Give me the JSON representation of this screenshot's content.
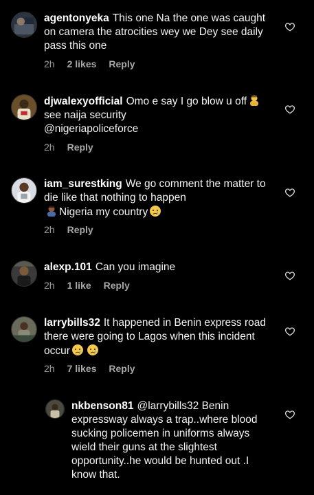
{
  "comments": [
    {
      "username": "agentonyeka",
      "text": "This one Na the one was caught on camera the atrocities wey we Dey see daily pass this one",
      "time": "2h",
      "likes": "2 likes",
      "reply": "Reply"
    },
    {
      "username": "djwalexyofficial",
      "text_a": "Omo e say I go blow u off",
      "text_b": "see naija security",
      "text_c": "@nigeriapoliceforce",
      "time": "2h",
      "reply": "Reply"
    },
    {
      "username": "iam_surestking",
      "text_a": "We go comment the matter to die like that nothing to happen",
      "text_b": "Nigeria my country",
      "time": "2h",
      "reply": "Reply"
    },
    {
      "username": "alexp.101",
      "text": "Can you imagine",
      "time": "2h",
      "likes": "1 like",
      "reply": "Reply"
    },
    {
      "username": "larrybills32",
      "text": "It happened in Benin express road there were going to Lagos when this incident occur",
      "time": "2h",
      "likes": "7 likes",
      "reply": "Reply"
    }
  ],
  "reply_comment": {
    "username": "nkbenson81",
    "text": "@larrybills32 Benin expressway always a trap..where blood sucking policemen in uniforms always wield their guns at the slightest opportunity..he would be hunted out .I know that."
  },
  "icons": {
    "like": "heart-outline-icon"
  },
  "colors": {
    "background": "#000000",
    "text": "#f3f3f3",
    "meta": "#9a9a9a"
  }
}
